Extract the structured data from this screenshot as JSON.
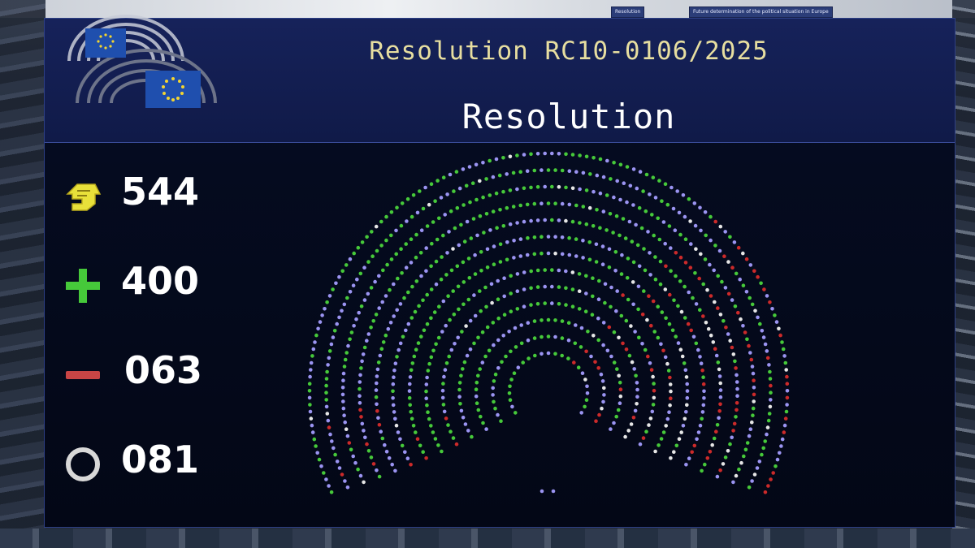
{
  "screen": {
    "document_reference": "Resolution RC10-0106/2025",
    "vote_title": "Resolution",
    "top_screens": [
      "Resolution",
      "Future determination of the political situation in Europe"
    ]
  },
  "tallies": [
    {
      "id": "present",
      "icon": "voting-hand-icon",
      "label": "",
      "value": "544",
      "color": "#e8e03a"
    },
    {
      "id": "for",
      "icon": "plus-icon",
      "label": "",
      "value": "400",
      "color": "#46c93a"
    },
    {
      "id": "against",
      "icon": "minus-icon",
      "label": "",
      "value": "063",
      "color": "#c94545"
    },
    {
      "id": "abstention",
      "icon": "circle-icon",
      "label": "",
      "value": "081",
      "color": "#d8d8d8"
    }
  ],
  "hemicycle": {
    "colors": {
      "for": "#46c93a",
      "against": "#cc2a2a",
      "abstention": "#e6e6e6",
      "not_voting": "#9b94f2"
    },
    "counts": {
      "for": 400,
      "against": 63,
      "abstention": 81
    }
  }
}
